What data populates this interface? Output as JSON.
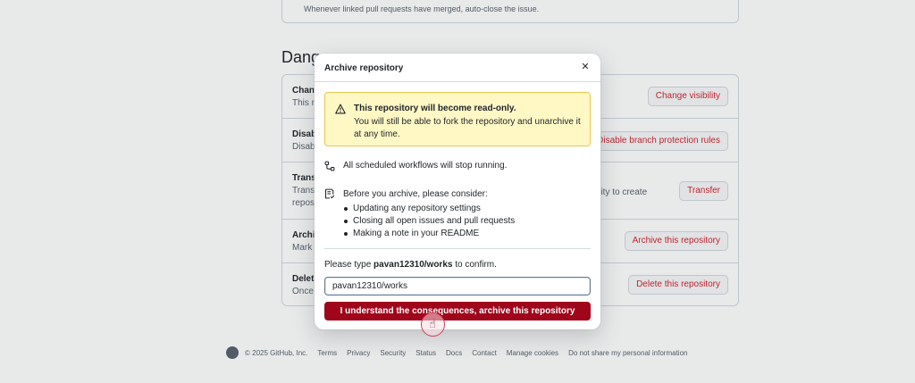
{
  "background": {
    "prev_section_desc": "Whenever linked pull requests have merged, auto-close the issue.",
    "danger_zone_title": "Dang",
    "rows": [
      {
        "title": "Chang",
        "sub": "This re",
        "button": "Change visibility"
      },
      {
        "title": "Disabl",
        "sub": "Disabl",
        "button": "Disable branch protection rules"
      },
      {
        "title": "Transf",
        "sub": "Transf",
        "sub2": "reposi",
        "mid_text": "ility to create",
        "button": "Transfer"
      },
      {
        "title": "Archiv",
        "sub": "Mark t",
        "button": "Archive this repository"
      },
      {
        "title": "Delete",
        "sub": "Once y",
        "button": "Delete this repository"
      }
    ]
  },
  "dialog": {
    "title": "Archive repository",
    "close_icon": "close-icon",
    "warning": {
      "icon": "alert-icon",
      "title": "This repository will become read-only.",
      "text": "You will still be able to fork the repository and unarchive it at any time."
    },
    "workflows_text": "All scheduled workflows will stop running.",
    "consider_text": "Before you archive, please consider:",
    "consider_items": [
      "Updating any repository settings",
      "Closing all open issues and pull requests",
      "Making a note in your README"
    ],
    "confirm_prefix": "Please type ",
    "confirm_repo": "pavan12310/works",
    "confirm_suffix": " to confirm.",
    "input_value": "pavan12310/works",
    "submit_label": "I understand the consequences, archive this repository"
  },
  "footer": {
    "copyright": "© 2025 GitHub, Inc.",
    "links": [
      "Terms",
      "Privacy",
      "Security",
      "Status",
      "Docs",
      "Contact",
      "Manage cookies",
      "Do not share my personal information"
    ]
  },
  "colors": {
    "danger": "#d1242f",
    "danger_button_bg": "#a0061b",
    "warning_bg": "#fff8c5",
    "warning_border": "#eac54f"
  }
}
